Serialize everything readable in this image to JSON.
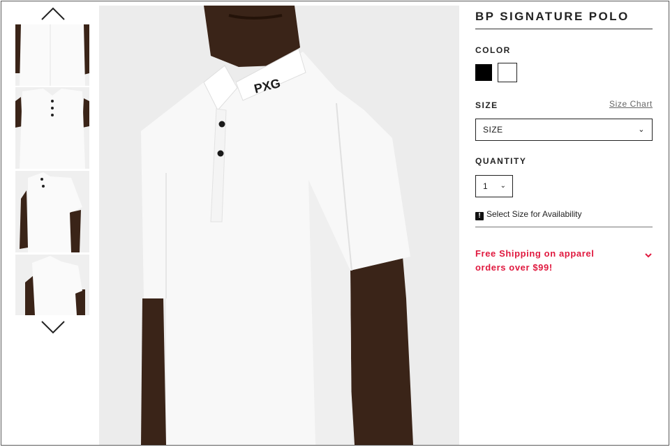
{
  "product": {
    "title": "BP SIGNATURE POLO"
  },
  "color": {
    "label": "COLOR",
    "swatches": [
      {
        "name": "Black",
        "hex": "#000000",
        "selected": false
      },
      {
        "name": "White",
        "hex": "#ffffff",
        "selected": true
      }
    ]
  },
  "size": {
    "label": "SIZE",
    "chart_link": "Size Chart",
    "selected": "SIZE"
  },
  "quantity": {
    "label": "QUANTITY",
    "value": "1"
  },
  "availability": {
    "text": "Select Size for Availability",
    "icon_glyph": "!"
  },
  "shipping": {
    "text": "Free Shipping on apparel orders over $99!"
  },
  "gallery": {
    "logo_text": "PXG",
    "icons": {
      "up": "chevron-up-icon",
      "down": "chevron-down-icon",
      "select": "chevron-down-icon"
    }
  },
  "colors": {
    "accent": "#e0193f",
    "text": "#222222",
    "skin": "#3a2418"
  }
}
